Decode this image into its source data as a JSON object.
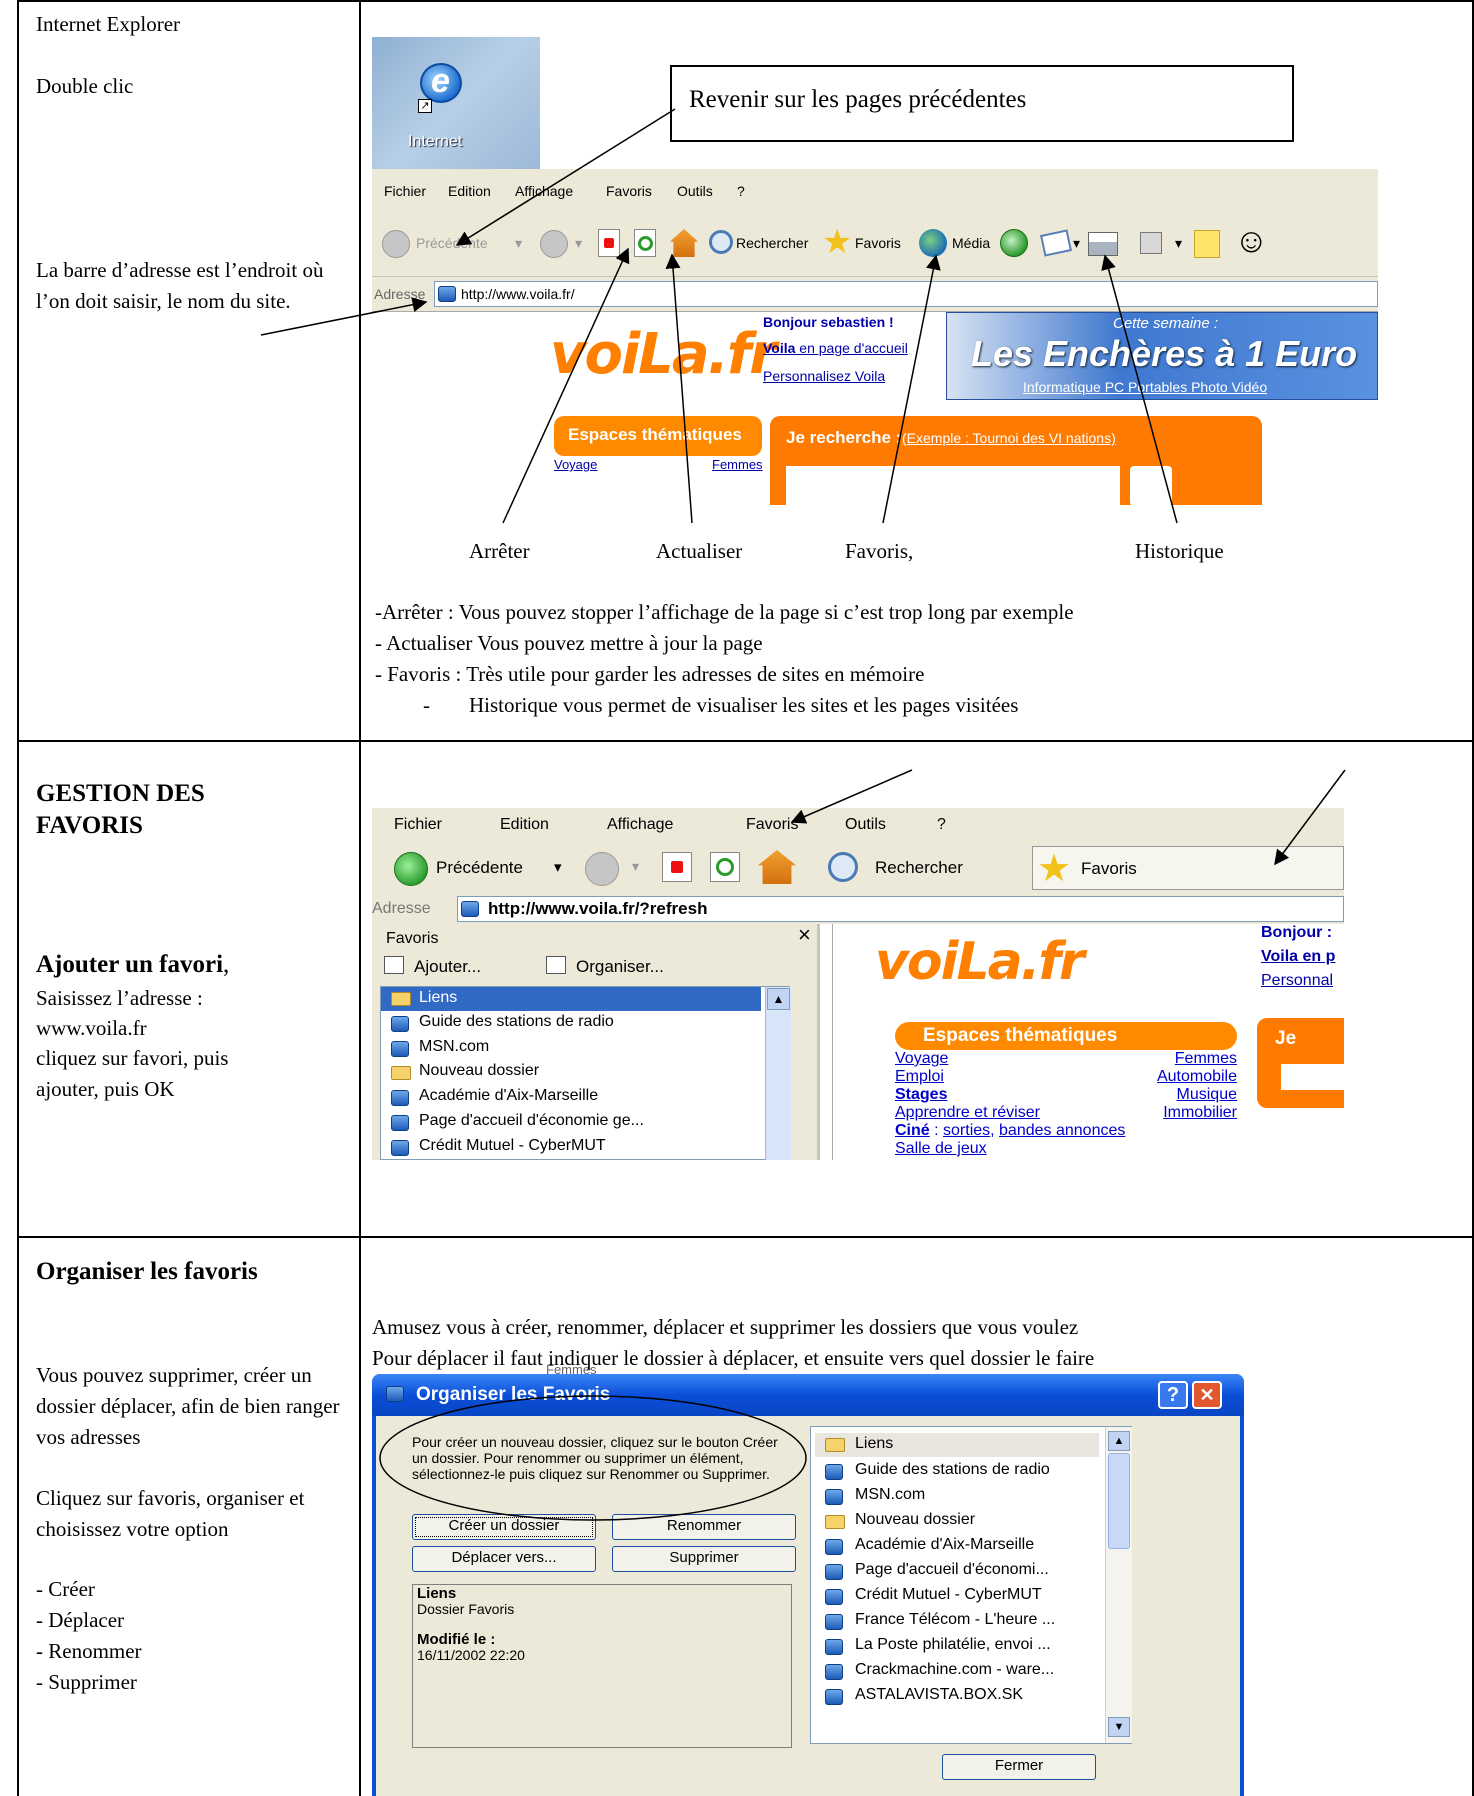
{
  "section1": {
    "left": {
      "title": "Internet Explorer",
      "double_click": "Double clic",
      "address_bar_desc": "La barre d’adresse est l’endroit où l’on doit saisir, le nom du site."
    },
    "desktop_icon_label": "Internet",
    "callout": "Revenir sur les pages précédentes",
    "menu": [
      "Fichier",
      "Edition",
      "Affichage",
      "Favoris",
      "Outils",
      "?"
    ],
    "toolbar": {
      "back": "Précédente",
      "search": "Rechercher",
      "favorites": "Favoris",
      "media": "Média"
    },
    "address": {
      "label": "Adresse",
      "url": "http://www.voila.fr/"
    },
    "voila": {
      "logo": "voiLa.fr",
      "greeting": "Bonjour sebastien !",
      "home_bold": "Voila",
      "home_rest": " en page d'accueil",
      "personalize": "Personnalisez Voila",
      "banner_top": "Cette semaine :",
      "banner_main": "Les Enchères à 1 Euro",
      "banner_links": "Informatique PC Portables Photo Vidéo",
      "espaces": "Espaces thématiques",
      "voyage": "Voyage",
      "femmes": "Femmes",
      "je_recherche": "Je recherche :",
      "exemple": "(Exemple : Tournoi des VI nations)"
    },
    "labels": {
      "arreter": "Arrêter",
      "actualiser": "Actualiser",
      "favoris": "Favoris,",
      "historique": "Historique"
    },
    "explanations": [
      "-Arrêter : Vous pouvez stopper l’affichage de la page si c’est trop long par exemple",
      "- Actualiser  Vous pouvez mettre à jour la page",
      "- Favoris : Très utile pour garder les adresses de sites en mémoire"
    ],
    "explanation_history_dash": "-",
    "explanation_history": "Historique vous permet de visualiser les sites et les pages visitées"
  },
  "section2": {
    "left": {
      "title": "GESTION DES FAVORIS",
      "subtitle": "Ajouter un favori",
      "subtitle_suffix": ",",
      "line1": "Saisissez l’adresse :",
      "line2": "www.voila.fr",
      "line3": "cliquez sur favori, puis ajouter, puis OK"
    },
    "menu": [
      "Fichier",
      "Edition",
      "Affichage",
      "Favoris",
      "Outils",
      "?"
    ],
    "toolbar": {
      "back": "Précédente",
      "search": "Rechercher",
      "favorites": "Favoris"
    },
    "address": {
      "label": "Adresse",
      "url": "http://www.voila.fr/?refresh"
    },
    "panel": {
      "title": "Favoris",
      "close": "×",
      "add": "Ajouter...",
      "organize": "Organiser...",
      "items": [
        "Liens",
        "Guide des stations de radio",
        "MSN.com",
        "Nouveau dossier",
        "Académie d'Aix-Marseille",
        "Page d'accueil d'économie ge...",
        "Crédit Mutuel - CyberMUT"
      ]
    },
    "voila": {
      "logo": "voiLa.fr",
      "bonjour": "Bonjour :",
      "voila_en": "Voila en p",
      "personnal": "Personnal",
      "espaces": "Espaces thématiques",
      "links_left": [
        "Voyage",
        "Emploi",
        "Stages",
        "Apprendre et réviser"
      ],
      "links_right": [
        "Femmes",
        "Automobile",
        "Musique",
        "Immobilier"
      ],
      "cine": "Ciné",
      "cine_rest_sep": " : ",
      "sorties": "sorties",
      "comma": ", ",
      "annonces": "bandes annonces",
      "salle": "Salle de jeux",
      "je": "Je"
    }
  },
  "section3": {
    "left": {
      "title": "Organiser les favoris",
      "para1": "Vous pouvez supprimer, créer un dossier déplacer, afin de bien ranger vos adresses",
      "para2": "Cliquez sur favoris, organiser et choisissez votre option",
      "options": [
        "- Créer",
        "- Déplacer",
        "- Renommer",
        "- Supprimer"
      ]
    },
    "instructions": [
      "Amusez vous à créer, renommer, déplacer et supprimer les dossiers que vous voulez",
      "Pour déplacer il faut indiquer le dossier à déplacer, et ensuite vers quel dossier le faire"
    ],
    "dialog": {
      "title": "Organiser les Favoris",
      "help": "?",
      "close": "✕",
      "instructions": "Pour créer un nouveau dossier, cliquez sur le bouton Créer un dossier. Pour renommer ou supprimer un élément, sélectionnez-le puis cliquez sur Renommer ou Supprimer.",
      "buttons": {
        "create": "Créer un dossier",
        "rename": "Renommer",
        "move": "Déplacer vers...",
        "delete": "Supprimer",
        "close": "Fermer"
      },
      "info": {
        "name": "Liens",
        "type": "Dossier Favoris",
        "modified_label": "Modifié le :",
        "modified_value": "16/11/2002 22:20"
      },
      "list": [
        "Liens",
        "Guide des stations de radio",
        "MSN.com",
        "Nouveau dossier",
        "Académie d'Aix-Marseille",
        "Page d'accueil d'économi...",
        "Crédit Mutuel - CyberMUT",
        "France Télécom - L'heure ...",
        "La Poste  philatélie, envoi ...",
        "Crackmachine.com - ware...",
        "ASTALAVISTA.BOX.SK"
      ],
      "behind_text": "Femmes"
    }
  }
}
